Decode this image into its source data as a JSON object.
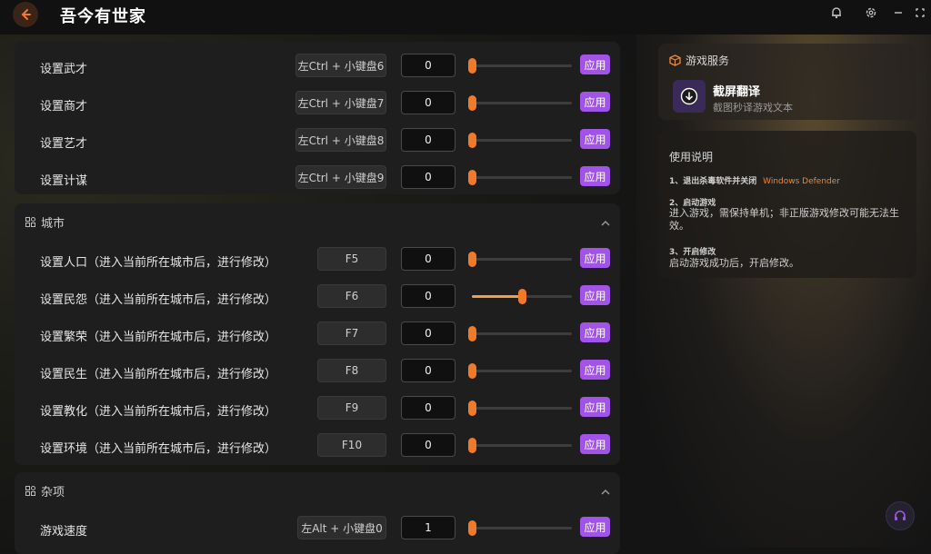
{
  "app": {
    "title": "吾今有世家"
  },
  "section_top": {
    "rows": [
      {
        "label": "设置武才",
        "hotkey": "左Ctrl + 小键盘6",
        "value": "0",
        "slider": 0
      },
      {
        "label": "设置商才",
        "hotkey": "左Ctrl + 小键盘7",
        "value": "0",
        "slider": 0
      },
      {
        "label": "设置艺才",
        "hotkey": "左Ctrl + 小键盘8",
        "value": "0",
        "slider": 0
      },
      {
        "label": "设置计谋",
        "hotkey": "左Ctrl + 小键盘9",
        "value": "0",
        "slider": 0
      }
    ]
  },
  "section_city": {
    "title": "城市",
    "rows": [
      {
        "label": "设置人口（进入当前所在城市后，进行修改）",
        "hotkey": "F5",
        "value": "0",
        "slider": 0
      },
      {
        "label": "设置民怨（进入当前所在城市后，进行修改）",
        "hotkey": "F6",
        "value": "0",
        "slider": 0.5
      },
      {
        "label": "设置繁荣（进入当前所在城市后，进行修改）",
        "hotkey": "F7",
        "value": "0",
        "slider": 0
      },
      {
        "label": "设置民生（进入当前所在城市后，进行修改）",
        "hotkey": "F8",
        "value": "0",
        "slider": 0
      },
      {
        "label": "设置教化（进入当前所在城市后，进行修改）",
        "hotkey": "F9",
        "value": "0",
        "slider": 0
      },
      {
        "label": "设置环境（进入当前所在城市后，进行修改）",
        "hotkey": "F10",
        "value": "0",
        "slider": 0
      }
    ]
  },
  "section_misc": {
    "title": "杂项",
    "rows": [
      {
        "label": "游戏速度",
        "hotkey": "左Alt + 小键盘0",
        "value": "1",
        "slider": 0
      }
    ]
  },
  "apply_label": "应用",
  "service": {
    "header": "游戏服务",
    "item_title": "截屏翻译",
    "item_desc": "截图秒译游戏文本"
  },
  "help": {
    "title": "使用说明",
    "step1_title": "1、退出杀毒软件并关闭",
    "step1_link": "Windows Defender",
    "step2_title": "2、启动游戏",
    "step2_body": "进入游戏，需保持单机；非正版游戏修改可能无法生效。",
    "step3_title": "3、开启修改",
    "step3_body": "启动游戏成功后，开启修改。"
  },
  "colors": {
    "accent": "#a254e8",
    "slider_thumb": "#f07a2a",
    "link": "#e88a3a"
  }
}
